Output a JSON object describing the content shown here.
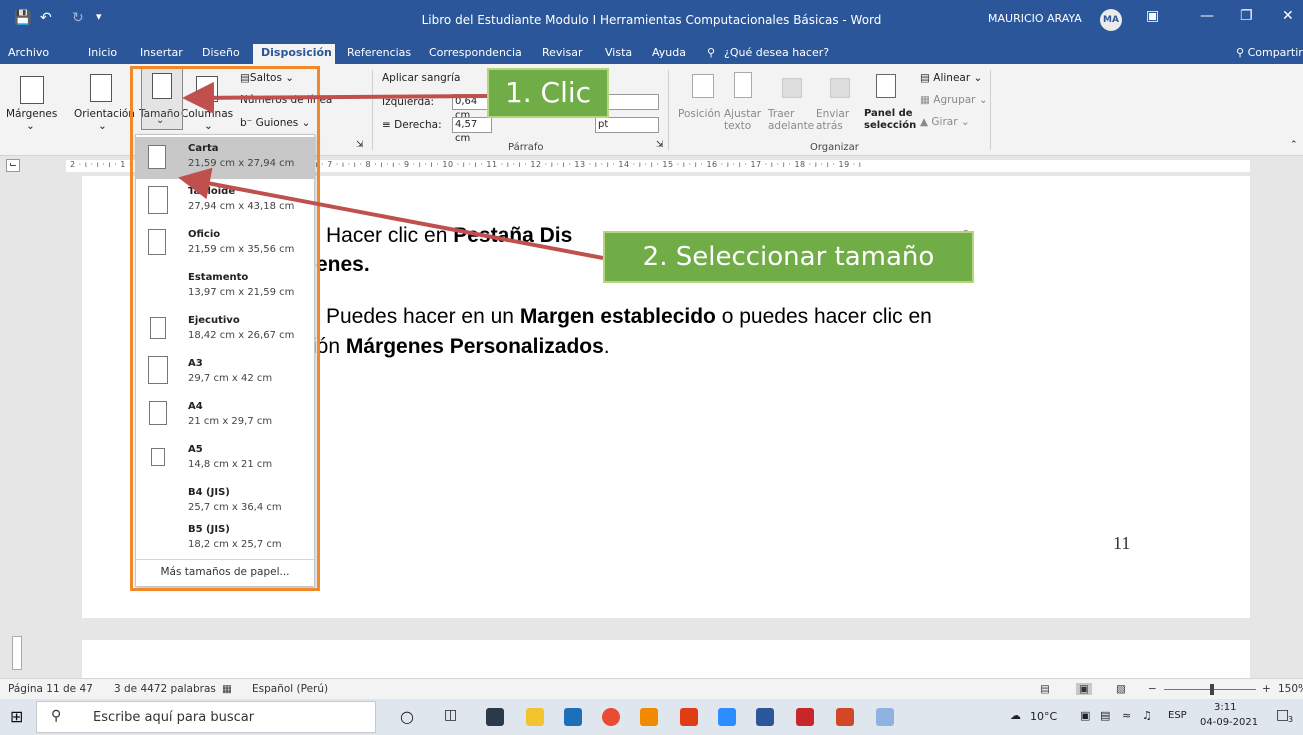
{
  "window": {
    "title": "Libro del Estudiante Modulo I Herramientas Computacionales Básicas  -  Word",
    "user_name": "MAURICIO ARAYA",
    "user_initials": "MA"
  },
  "menu": {
    "tabs": [
      "Archivo",
      "Inicio",
      "Insertar",
      "Diseño",
      "Disposición",
      "Referencias",
      "Correspondencia",
      "Revisar",
      "Vista",
      "Ayuda"
    ],
    "search_hint": "¿Qué desea hacer?",
    "share": "Compartir"
  },
  "ribbon": {
    "margenes": "Márgenes",
    "orientacion": "Orientación",
    "tamano": "Tamaño",
    "columnas": "Columnas",
    "saltos": "Saltos",
    "numeros_linea": "Números de línea",
    "guiones": "Guiones",
    "aplicar_sangria": "Aplicar sangría",
    "izquierda": "Izquierda:",
    "izquierda_value": "0,64 cm",
    "derecha": "Derecha:",
    "derecha_value": "4,57 cm",
    "pt1": "pt",
    "pt2": "pt",
    "parrafo": "Párrafo",
    "posicion": "Posición",
    "ajustar_texto": "Ajustar texto",
    "traer_adelante": "Traer adelante",
    "enviar_atras": "Enviar atrás",
    "panel_seleccion": "Panel de selección",
    "alinear": "Alinear",
    "agrupar": "Agrupar",
    "girar": "Girar",
    "organizar": "Organizar"
  },
  "ruler_text": "2 · ı · ı · ı · 1 · ı · 2 · ı · 3 · ı · ı · 4 · ı · ı · 5 · ı · ı · 6 · ı · ı · 7 · ı · ı · 8 · ı · ı · 9 · ı · ı · 10 · ı · ı · 11 · ı · ı · 12 · ı · ı · 13 · ı · ı · 14 · ı · ı · 15 · ı · ı · 16 · ı · ı · 17 · ı · ı · 18 · ı · ı · 19 · ı",
  "page_sizes": [
    {
      "name": "Carta",
      "size": "21,59 cm x 27,94 cm"
    },
    {
      "name": "Tabloide",
      "size": "27,94 cm x 43,18 cm"
    },
    {
      "name": "Oficio",
      "size": "21,59 cm x 35,56 cm"
    },
    {
      "name": "Estamento",
      "size": "13,97 cm x 21,59 cm"
    },
    {
      "name": "Ejecutivo",
      "size": "18,42 cm x 26,67 cm"
    },
    {
      "name": "A3",
      "size": "29,7 cm x 42 cm"
    },
    {
      "name": "A4",
      "size": "21 cm x 29,7 cm"
    },
    {
      "name": "A5",
      "size": "14,8 cm x 21 cm"
    },
    {
      "name": "B4 (JIS)",
      "size": "25,7 cm x 36,4 cm"
    },
    {
      "name": "B5 (JIS)",
      "size": "18,2 cm x 25,7 cm"
    }
  ],
  "more_sizes": "Más tamaños de papel...",
  "doc": {
    "line1_pre": "Hacer clic en ",
    "line1_bold": "Pestaña Dis",
    "line1_tail": "a",
    "line2_bold": "enes.",
    "line3_pre": "Puedes hacer en un ",
    "line3_bold": "Margen establecido",
    "line3_post": " o puedes hacer clic en",
    "line4_pre": "ión ",
    "line4_bold": "Márgenes Personalizados",
    "line4_post": ".",
    "page_number": "11"
  },
  "callouts": {
    "c1": "1. Clic",
    "c2": "2. Seleccionar tamaño"
  },
  "status": {
    "page": "Página 11 de 47",
    "words": "3 de 4472 palabras",
    "language": "Español (Perú)",
    "zoom": "150%"
  },
  "taskbar": {
    "search_placeholder": "Escribe aquí para buscar",
    "temperature": "10°C",
    "lang": "ESP",
    "time": "3:11",
    "date": "04-09-2021",
    "notifications": "3"
  }
}
